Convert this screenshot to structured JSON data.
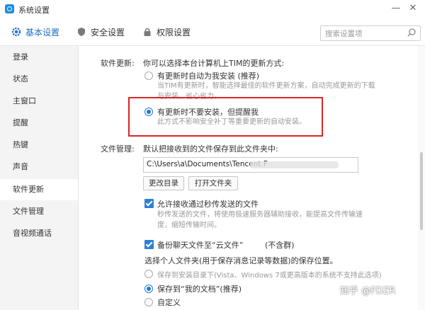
{
  "window": {
    "title": "系统设置",
    "minimize_glyph": "—",
    "close_glyph": "✕"
  },
  "tabs": [
    {
      "label": "基本设置",
      "icon": "gear-icon",
      "active": true
    },
    {
      "label": "安全设置",
      "icon": "shield-icon",
      "active": false
    },
    {
      "label": "权限设置",
      "icon": "lock-icon",
      "active": false
    }
  ],
  "search": {
    "placeholder": "搜索设置项"
  },
  "sidebar": {
    "items": [
      {
        "label": "登录"
      },
      {
        "label": "状态"
      },
      {
        "label": "主窗口"
      },
      {
        "label": "提醒"
      },
      {
        "label": "热键"
      },
      {
        "label": "声音"
      },
      {
        "label": "软件更新",
        "active": true
      },
      {
        "label": "文件管理"
      },
      {
        "label": "音视频通话"
      }
    ]
  },
  "software_update": {
    "label": "软件更新:",
    "intro": "你可以选择本台计算机上TIM的更新方式:",
    "options": [
      {
        "label": "有更新时自动为我安装 (推荐)",
        "desc": "当TIM有更新时，智能选择最佳的软件更新方案，自动完成更新的下载与安装，省心省力。",
        "selected": false
      },
      {
        "label": "有更新时不要安装，但提醒我",
        "desc": "此方式不影响安全补丁等重要更新的自动安装。",
        "selected": true
      }
    ]
  },
  "file_management": {
    "label": "文件管理:",
    "default_save_text": "默认把接收到的文件保存到此文件夹中:",
    "path_value": "C:\\Users\\a\\Documents\\Tencent F",
    "buttons": {
      "change_dir": "更改目录",
      "open_folder": "打开文件夹"
    },
    "allow_instant": {
      "label": "允许接收通过秒传发送的文件",
      "checked": true,
      "desc": "秒传发送的文件，将使用极速服务器辅助接收，能提高文件传输速度，缩短传输时间。"
    },
    "backup_chat": {
      "label": "备份聊天文件至“云文件”",
      "suffix": "(不含群)",
      "checked": true
    },
    "personal_folder_text": "选择个人文件夹(用于保存消息记录等数据)的保存位置。",
    "location_options": [
      {
        "label": "保存到安装目录下(Vista、Windows 7或更高版本的系统不支持此选项)",
        "selected": false
      },
      {
        "label": "保存到“我的文档”(推荐)",
        "selected": true
      },
      {
        "label": "自定义",
        "selected": false
      }
    ]
  },
  "watermark": "知乎 @FDZR",
  "colors": {
    "accent": "#1f78d1",
    "highlight": "#d8262b"
  }
}
